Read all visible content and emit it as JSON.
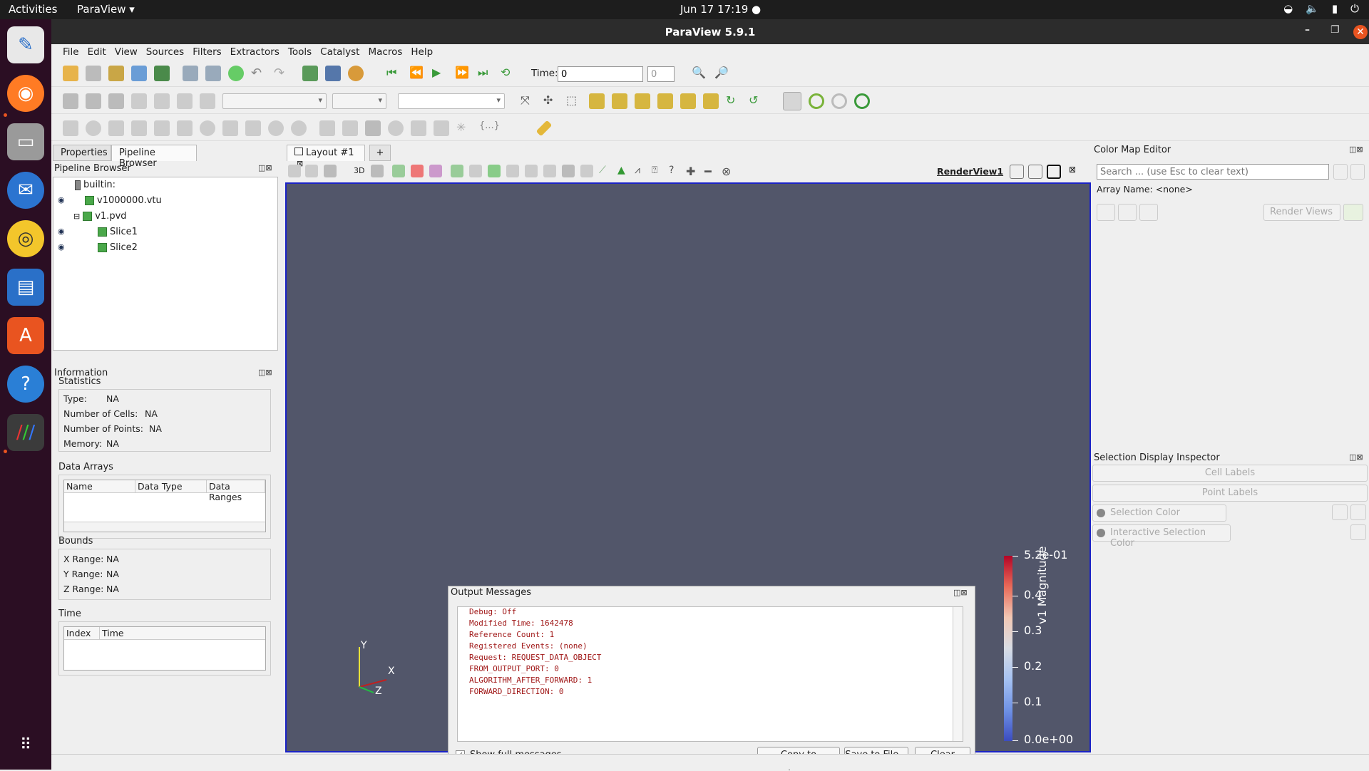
{
  "topbar": {
    "activities": "Activities",
    "app_name": "ParaView ▾",
    "clock": "Jun 17  17:19  ●"
  },
  "window": {
    "title": "ParaView 5.9.1"
  },
  "menu": [
    "File",
    "Edit",
    "View",
    "Sources",
    "Filters",
    "Extractors",
    "Tools",
    "Catalyst",
    "Macros",
    "Help"
  ],
  "toolbar": {
    "time_label": "Time:",
    "time_value": "0",
    "time_step": "0"
  },
  "left": {
    "tabs": [
      "Properties",
      "Pipeline Browser"
    ],
    "pipeline_title": "Pipeline Browser",
    "pipeline": [
      {
        "name": "builtin:",
        "indent": 0
      },
      {
        "name": "v1000000.vtu",
        "indent": 1,
        "eye": true
      },
      {
        "name": "v1.pvd",
        "indent": 1,
        "eye": false,
        "expand": "⊟"
      },
      {
        "name": "Slice1",
        "indent": 2,
        "eye": true
      },
      {
        "name": "Slice2",
        "indent": 2,
        "eye": true
      }
    ],
    "info_title": "Information",
    "statistics_title": "Statistics",
    "stats": {
      "type_label": "Type:",
      "type": "NA",
      "cells_label": "Number of Cells:",
      "cells": "NA",
      "points_label": "Number of Points:",
      "points": "NA",
      "memory_label": "Memory:",
      "memory": "NA"
    },
    "arrays_title": "Data Arrays",
    "arrays_cols": [
      "Name",
      "Data Type",
      "Data Ranges"
    ],
    "bounds_title": "Bounds",
    "bounds": {
      "x_label": "X Range:",
      "x": "NA",
      "y_label": "Y Range:",
      "y": "NA",
      "z_label": "Z Range:",
      "z": "NA"
    },
    "time_title": "Time",
    "time_cols": [
      "Index",
      "Time"
    ]
  },
  "center": {
    "layout_tab": "Layout #1",
    "add_tab": "+",
    "view_name": "RenderView1",
    "mode3d": "3D",
    "axes": {
      "x": "X",
      "y": "Y",
      "z": "Z"
    },
    "colorbar": {
      "title": "v1 Magnitude",
      "labels": [
        "5.2e-01",
        "0.4",
        "0.3",
        "0.2",
        "0.1",
        "0.0e+00"
      ],
      "top": "#b40426",
      "bottom": "#3b4cc0"
    }
  },
  "output": {
    "title": "Output Messages",
    "lines": [
      "Debug: Off",
      "Modified Time: 1642478",
      "Reference Count: 1",
      "Registered Events: (none)",
      "Request: REQUEST_DATA_OBJECT",
      "FROM_OUTPUT_PORT: 0",
      "ALGORITHM_AFTER_FORWARD: 1",
      "FORWARD_DIRECTION: 0"
    ],
    "show_full": "Show full messages",
    "copy": "Copy to Clipboard",
    "save": "Save to File...",
    "clear": "Clear"
  },
  "right": {
    "cme_title": "Color Map Editor",
    "search_placeholder": "Search ... (use Esc to clear text)",
    "array_name": "Array Name: <none>",
    "render_views": "Render Views",
    "sdi_title": "Selection Display Inspector",
    "cell_labels": "Cell Labels",
    "point_labels": "Point Labels",
    "selection_color": "Selection Color",
    "interactive_color": "Interactive Selection Color"
  }
}
